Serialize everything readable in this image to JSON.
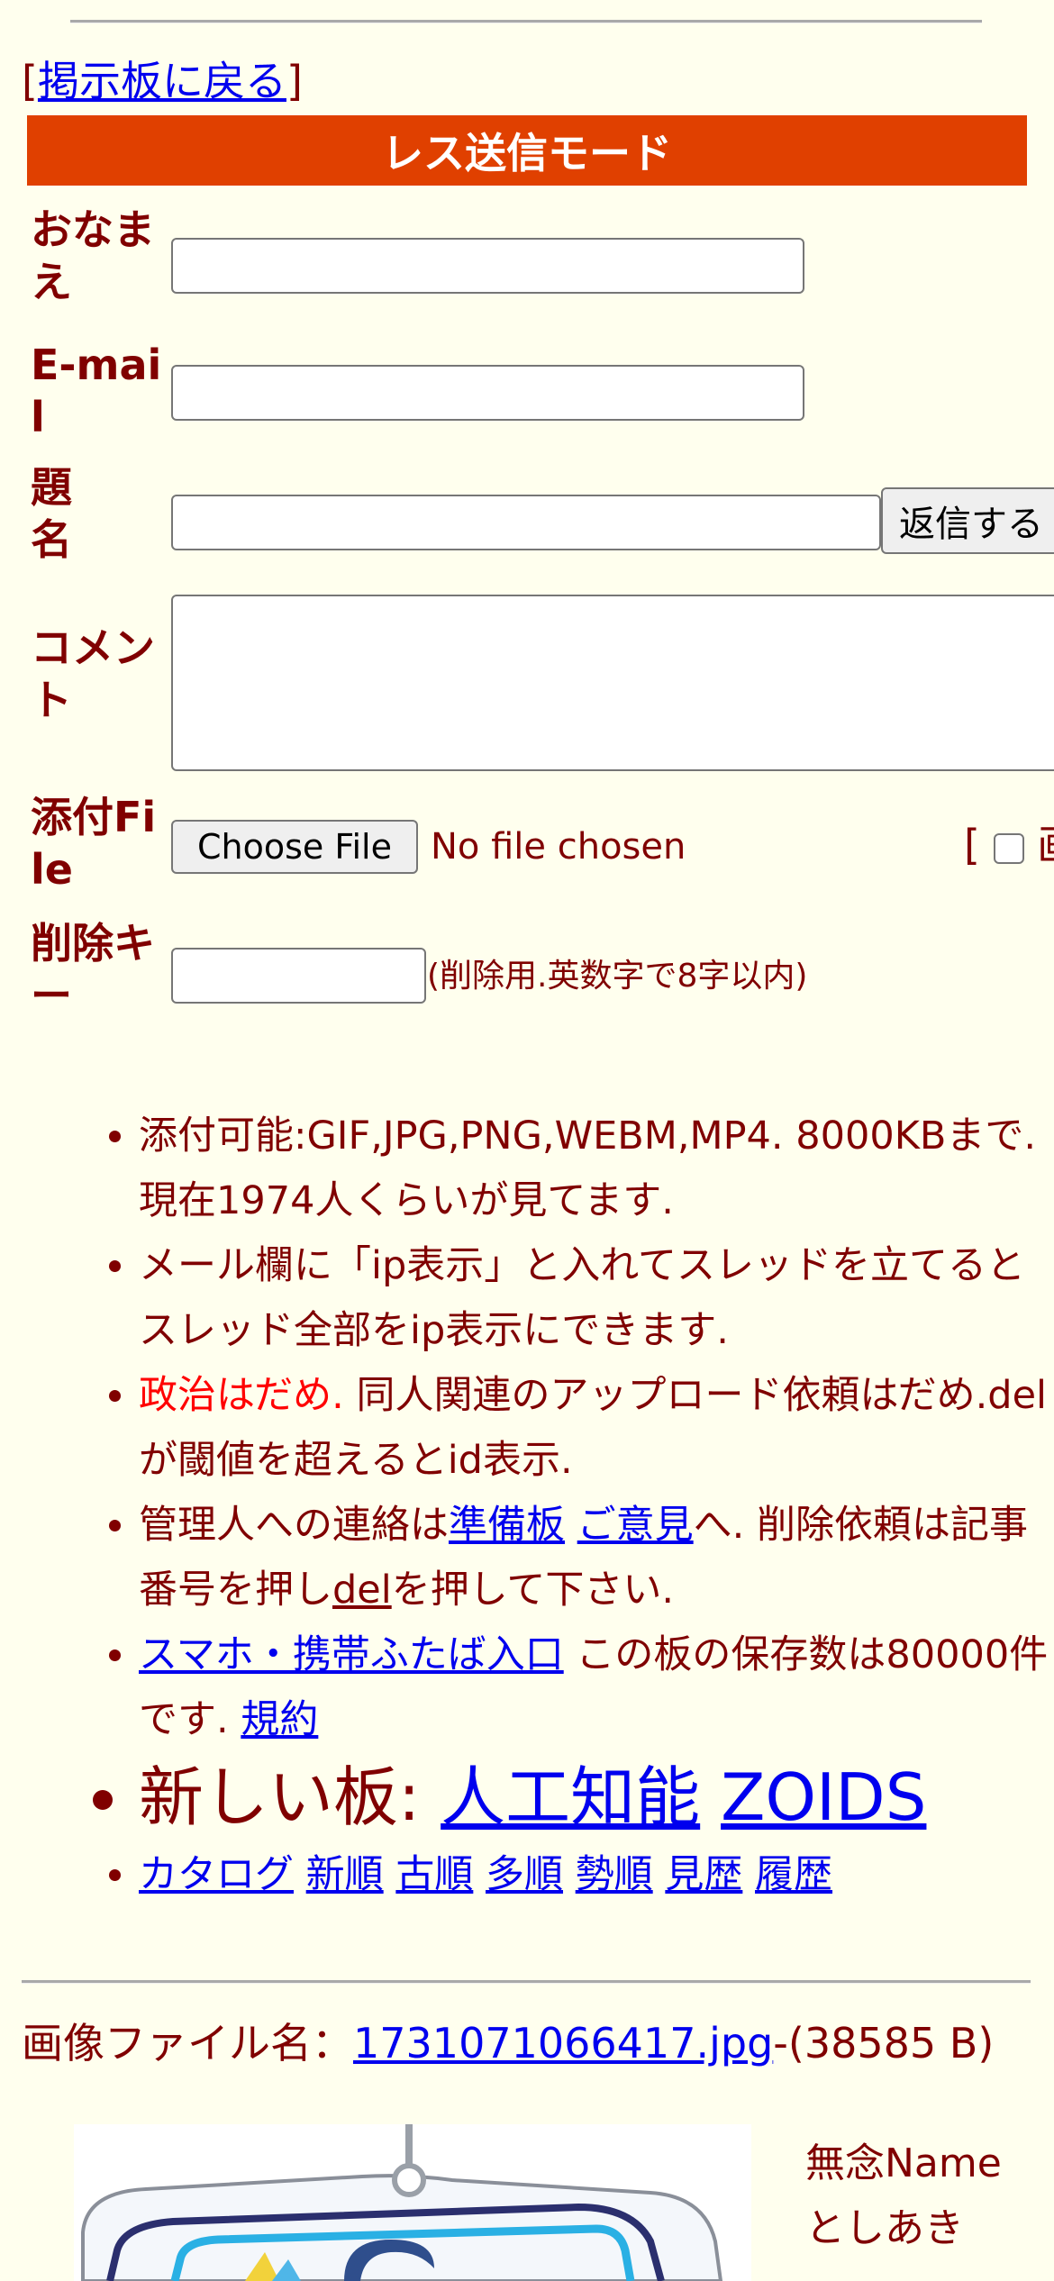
{
  "nav": {
    "back_open": "[",
    "back_label": "掲示板に戻る",
    "back_close": "]"
  },
  "form": {
    "mode_title": "レス送信モード",
    "name_label": "おなまえ",
    "email_label": "E-mail",
    "subject_label": "題名",
    "submit_label": "返信する",
    "comment_label": "コメント",
    "file_label": "添付File",
    "file_button": "Choose File",
    "file_status": "No file chosen",
    "image_option_open": "[",
    "image_option_label": "画",
    "delkey_label": "削除キー",
    "delkey_hint": "(削除用.英数字で8字以内)"
  },
  "info": {
    "item1": "添付可能:GIF,JPG,PNG,WEBM,MP4. 8000KBまで. 現在1974人くらいが見てます.",
    "item2": "メール欄に「ip表示」と入れてスレッドを立てるとスレッド全部をip表示にできます.",
    "item3_red": "政治はだめ.",
    "item3_rest": " 同人関連のアップロード依頼はだめ.delが閾値を超えるとid表示.",
    "item4_pre": "管理人への連絡は",
    "item4_link1": "準備板",
    "item4_link2": "ご意見",
    "item4_mid": "へ. 削除依頼は記事番号を押し",
    "item4_link3": "del",
    "item4_post": "を押して下さい.",
    "item5_link": "スマホ・携帯ふたば入口",
    "item5_text": " この板の保存数は80000件です. ",
    "item5_link2": "規約",
    "item6_label": "新しい板: ",
    "item6_link1": "人工知能",
    "item6_link2": "ZOIDS",
    "sort_links": [
      "カタログ",
      "新順",
      "古順",
      "多順",
      "勢順",
      "見歴",
      "履歴"
    ]
  },
  "post": {
    "file_prefix": "画像ファイル名：",
    "file_name": "1731071066417.jpg",
    "file_size": "-(38585 B)",
    "name_line1": "無念Name",
    "name_line2": "としあき"
  }
}
